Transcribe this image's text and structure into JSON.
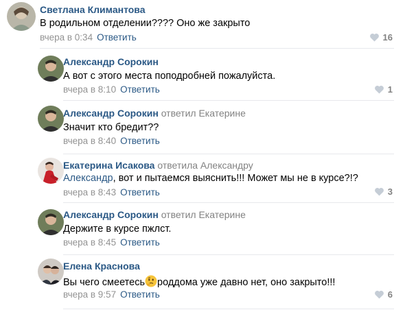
{
  "comments": [
    {
      "author": "Светлана Климантова",
      "reply_to": "",
      "text": "В родильном отделении???? Оно же закрыто",
      "time": "вчера в 0:34",
      "reply_label": "Ответить",
      "likes": "16"
    },
    {
      "author": "Александр Сорокин",
      "reply_to": "",
      "text": "А вот с этого места поподробней пожалуйста.",
      "time": "вчера в 8:10",
      "reply_label": "Ответить",
      "likes": "1"
    },
    {
      "author": "Александр Сорокин",
      "reply_to": "ответил Екатерине",
      "text": "Значит кто бредит??",
      "time": "вчера в 8:40",
      "reply_label": "Ответить",
      "likes": ""
    },
    {
      "author": "Екатерина Исакова",
      "reply_to": "ответила Александру",
      "mention": "Александр",
      "text": ", вот и пытаемся выяснить!!! Может мы не в курсе?!?",
      "time": "вчера в 8:43",
      "reply_label": "Ответить",
      "likes": "3"
    },
    {
      "author": "Александр Сорокин",
      "reply_to": "ответил Екатерине",
      "text": "Держите в курсе пжлст.",
      "time": "вчера в 8:45",
      "reply_label": "Ответить",
      "likes": ""
    },
    {
      "author": "Елена Краснова",
      "reply_to": "",
      "text_before": "Вы чего смеетесь",
      "text_after": "роддома уже давно нет, оно закрыто!!!",
      "time": "вчера в 9:57",
      "reply_label": "Ответить",
      "likes": "6"
    }
  ],
  "icons": {
    "like": "heart-icon",
    "emoji": "thinking-face-emoji"
  },
  "colors": {
    "link": "#2a5885",
    "meta": "#939393",
    "divider": "#e7e8ec"
  }
}
